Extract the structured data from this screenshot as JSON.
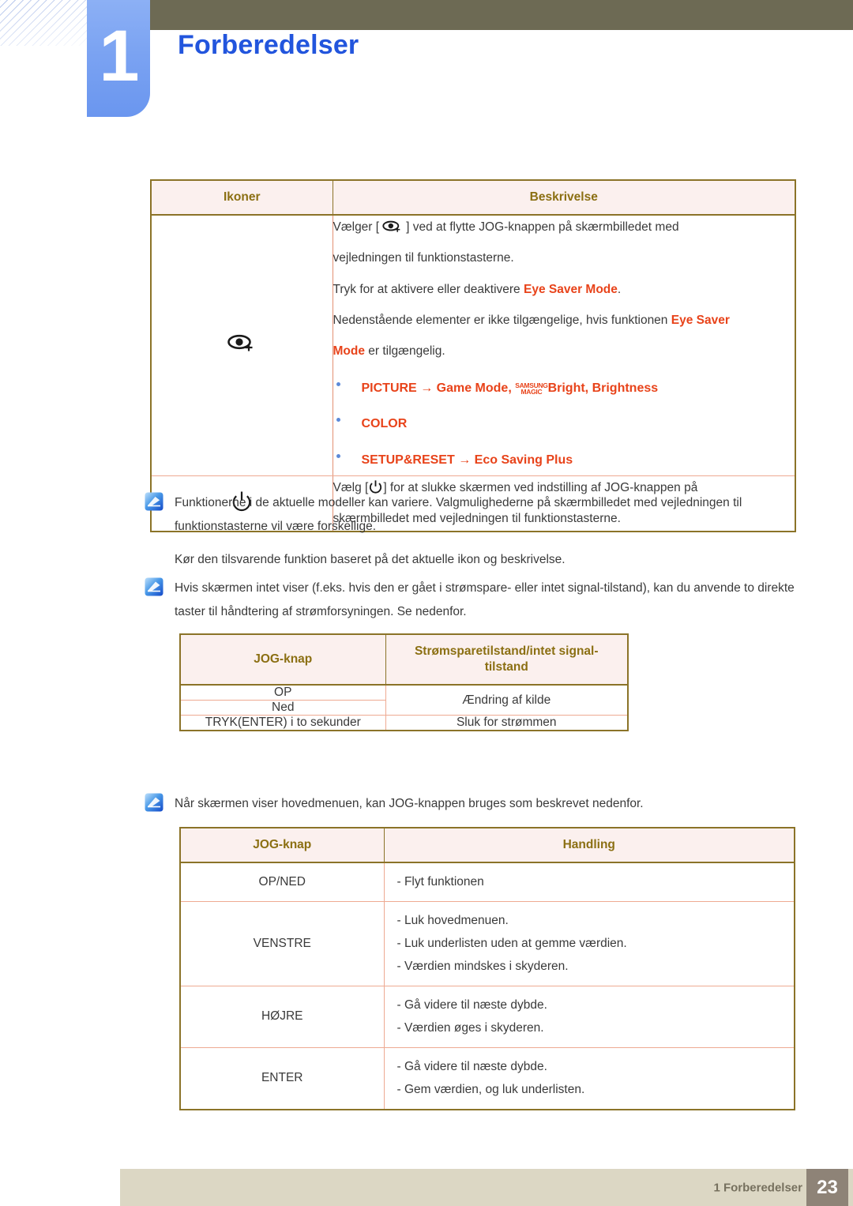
{
  "header": {
    "chapter_number": "1",
    "chapter_title": "Forberedelser"
  },
  "table_icons": {
    "headers": [
      "Ikoner",
      "Beskrivelse"
    ],
    "rows": [
      {
        "icon": "eye-saver-mode-icon",
        "lines": [
          "Vælger [",
          "] ved at flytte JOG-knappen på skærmbilledet med vejledningen til funktionstasterne.",
          "Tryk for at aktivere eller deaktivere ",
          "Eye Saver Mode",
          ".",
          "Nedenstående elementer er ikke tilgængelige, hvis funktionen ",
          "Eye Saver Mode",
          " er tilgængelig."
        ],
        "line1_prefix": "Vælger [",
        "line1_suffix": "] ved at flytte JOG-knappen på skærmbilledet med",
        "line2": "vejledningen til funktionstasterne.",
        "line3_prefix": "Tryk for at aktivere eller deaktivere ",
        "line3_hl": "Eye Saver Mode",
        "line3_suffix": ".",
        "line4_prefix": "Nedenstående elementer er ikke tilgængelige, hvis funktionen ",
        "line4_hl": "Eye Saver",
        "line5_hl": "Mode",
        "line5_suffix": " er tilgængelig.",
        "bullets": [
          {
            "menu": "PICTURE",
            "arrow": "→",
            "items_pre": "Game Mode, ",
            "magic_top": "SAMSUNG",
            "magic_bottom": "MAGIC",
            "items_post": "Bright, Brightness"
          },
          {
            "menu": "COLOR",
            "arrow": "",
            "items_pre": "",
            "magic_top": "",
            "magic_bottom": "",
            "items_post": ""
          },
          {
            "menu": "SETUP&RESET",
            "arrow": "→",
            "items_pre": "Eco Saving Plus",
            "magic_top": "",
            "magic_bottom": "",
            "items_post": ""
          }
        ]
      },
      {
        "icon": "power-icon",
        "line1_prefix": "Vælg [",
        "line1_suffix": "] for at slukke skærmen ved indstilling af JOG-knappen på",
        "line2": "skærmbilledet med vejledningen til funktionstasterne."
      }
    ]
  },
  "note_1": {
    "icon": "note-icon",
    "paragraph_1": "Funktionerne i de aktuelle modeller kan variere. Valgmulighederne på skærmbilledet med vejledningen til funktionstasterne vil være forskellige.",
    "paragraph_2": "Kør den tilsvarende funktion baseret på det aktuelle ikon og beskrivelse."
  },
  "note_2": {
    "icon": "note-icon",
    "paragraph_1": "Hvis skærmen intet viser (f.eks. hvis den er gået i strømspare- eller intet signal-tilstand), kan du anvende to direkte taster til håndtering af strømforsyningen. Se nedenfor."
  },
  "note_3": {
    "icon": "note-icon",
    "paragraph_1": "Når skærmen viser hovedmenuen, kan JOG-knappen bruges som beskrevet nedenfor."
  },
  "table_power": {
    "headers": [
      "JOG-knap",
      "Strømsparetilstand/intet signal-\ntilstand"
    ],
    "header_col1": "JOG-knap",
    "header_col2_line1": "Strømsparetilstand/intet signal-",
    "header_col2_line2": "tilstand",
    "rows": [
      {
        "key": "OP",
        "value": "Ændring af kilde"
      },
      {
        "key": "Ned",
        "value": ""
      },
      {
        "key": "TRYK(ENTER) i to sekunder",
        "value": "Sluk for strømmen"
      }
    ]
  },
  "table_action": {
    "header_col1": "JOG-knap",
    "header_col2": "Handling",
    "rows": [
      {
        "key": "OP/NED",
        "actions": [
          "- Flyt funktionen"
        ]
      },
      {
        "key": "VENSTRE",
        "actions": [
          "- Luk hovedmenuen.",
          "- Luk underlisten uden at gemme værdien.",
          "- Værdien mindskes i skyderen."
        ]
      },
      {
        "key": "HØJRE",
        "actions": [
          "- Gå videre til næste dybde.",
          "- Værdien øges i skyderen."
        ]
      },
      {
        "key": "ENTER",
        "actions": [
          "- Gå videre til næste dybde.",
          "- Gem værdien, og luk underlisten."
        ]
      }
    ]
  },
  "footer": {
    "label": "1 Forberedelser",
    "page_number": "23"
  },
  "colors": {
    "chapter_blue": "#7ba3f2",
    "title_blue": "#2255dd",
    "topbar": "#6d6a54",
    "table_border": "#8b7328",
    "table_header_bg": "#fbf0ee",
    "table_header_text": "#8b6f12",
    "highlight_red": "#e8431a",
    "footer_bar": "#dcd7c4",
    "footer_page_box": "#8e8377"
  }
}
